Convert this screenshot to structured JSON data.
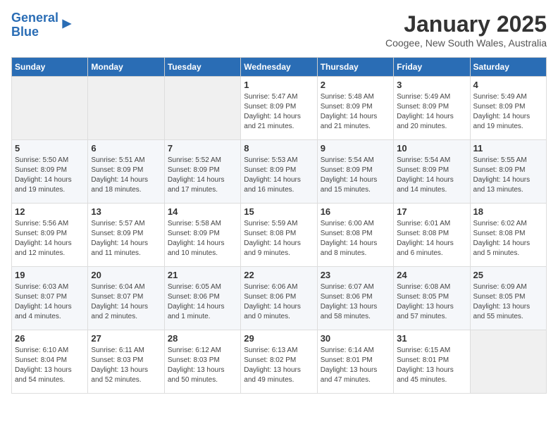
{
  "logo": {
    "text_general": "General",
    "text_blue": "Blue"
  },
  "header": {
    "title": "January 2025",
    "subtitle": "Coogee, New South Wales, Australia"
  },
  "weekdays": [
    "Sunday",
    "Monday",
    "Tuesday",
    "Wednesday",
    "Thursday",
    "Friday",
    "Saturday"
  ],
  "weeks": [
    [
      {
        "day": "",
        "info": ""
      },
      {
        "day": "",
        "info": ""
      },
      {
        "day": "",
        "info": ""
      },
      {
        "day": "1",
        "info": "Sunrise: 5:47 AM\nSunset: 8:09 PM\nDaylight: 14 hours\nand 21 minutes."
      },
      {
        "day": "2",
        "info": "Sunrise: 5:48 AM\nSunset: 8:09 PM\nDaylight: 14 hours\nand 21 minutes."
      },
      {
        "day": "3",
        "info": "Sunrise: 5:49 AM\nSunset: 8:09 PM\nDaylight: 14 hours\nand 20 minutes."
      },
      {
        "day": "4",
        "info": "Sunrise: 5:49 AM\nSunset: 8:09 PM\nDaylight: 14 hours\nand 19 minutes."
      }
    ],
    [
      {
        "day": "5",
        "info": "Sunrise: 5:50 AM\nSunset: 8:09 PM\nDaylight: 14 hours\nand 19 minutes."
      },
      {
        "day": "6",
        "info": "Sunrise: 5:51 AM\nSunset: 8:09 PM\nDaylight: 14 hours\nand 18 minutes."
      },
      {
        "day": "7",
        "info": "Sunrise: 5:52 AM\nSunset: 8:09 PM\nDaylight: 14 hours\nand 17 minutes."
      },
      {
        "day": "8",
        "info": "Sunrise: 5:53 AM\nSunset: 8:09 PM\nDaylight: 14 hours\nand 16 minutes."
      },
      {
        "day": "9",
        "info": "Sunrise: 5:54 AM\nSunset: 8:09 PM\nDaylight: 14 hours\nand 15 minutes."
      },
      {
        "day": "10",
        "info": "Sunrise: 5:54 AM\nSunset: 8:09 PM\nDaylight: 14 hours\nand 14 minutes."
      },
      {
        "day": "11",
        "info": "Sunrise: 5:55 AM\nSunset: 8:09 PM\nDaylight: 14 hours\nand 13 minutes."
      }
    ],
    [
      {
        "day": "12",
        "info": "Sunrise: 5:56 AM\nSunset: 8:09 PM\nDaylight: 14 hours\nand 12 minutes."
      },
      {
        "day": "13",
        "info": "Sunrise: 5:57 AM\nSunset: 8:09 PM\nDaylight: 14 hours\nand 11 minutes."
      },
      {
        "day": "14",
        "info": "Sunrise: 5:58 AM\nSunset: 8:09 PM\nDaylight: 14 hours\nand 10 minutes."
      },
      {
        "day": "15",
        "info": "Sunrise: 5:59 AM\nSunset: 8:08 PM\nDaylight: 14 hours\nand 9 minutes."
      },
      {
        "day": "16",
        "info": "Sunrise: 6:00 AM\nSunset: 8:08 PM\nDaylight: 14 hours\nand 8 minutes."
      },
      {
        "day": "17",
        "info": "Sunrise: 6:01 AM\nSunset: 8:08 PM\nDaylight: 14 hours\nand 6 minutes."
      },
      {
        "day": "18",
        "info": "Sunrise: 6:02 AM\nSunset: 8:08 PM\nDaylight: 14 hours\nand 5 minutes."
      }
    ],
    [
      {
        "day": "19",
        "info": "Sunrise: 6:03 AM\nSunset: 8:07 PM\nDaylight: 14 hours\nand 4 minutes."
      },
      {
        "day": "20",
        "info": "Sunrise: 6:04 AM\nSunset: 8:07 PM\nDaylight: 14 hours\nand 2 minutes."
      },
      {
        "day": "21",
        "info": "Sunrise: 6:05 AM\nSunset: 8:06 PM\nDaylight: 14 hours\nand 1 minute."
      },
      {
        "day": "22",
        "info": "Sunrise: 6:06 AM\nSunset: 8:06 PM\nDaylight: 14 hours\nand 0 minutes."
      },
      {
        "day": "23",
        "info": "Sunrise: 6:07 AM\nSunset: 8:06 PM\nDaylight: 13 hours\nand 58 minutes."
      },
      {
        "day": "24",
        "info": "Sunrise: 6:08 AM\nSunset: 8:05 PM\nDaylight: 13 hours\nand 57 minutes."
      },
      {
        "day": "25",
        "info": "Sunrise: 6:09 AM\nSunset: 8:05 PM\nDaylight: 13 hours\nand 55 minutes."
      }
    ],
    [
      {
        "day": "26",
        "info": "Sunrise: 6:10 AM\nSunset: 8:04 PM\nDaylight: 13 hours\nand 54 minutes."
      },
      {
        "day": "27",
        "info": "Sunrise: 6:11 AM\nSunset: 8:03 PM\nDaylight: 13 hours\nand 52 minutes."
      },
      {
        "day": "28",
        "info": "Sunrise: 6:12 AM\nSunset: 8:03 PM\nDaylight: 13 hours\nand 50 minutes."
      },
      {
        "day": "29",
        "info": "Sunrise: 6:13 AM\nSunset: 8:02 PM\nDaylight: 13 hours\nand 49 minutes."
      },
      {
        "day": "30",
        "info": "Sunrise: 6:14 AM\nSunset: 8:01 PM\nDaylight: 13 hours\nand 47 minutes."
      },
      {
        "day": "31",
        "info": "Sunrise: 6:15 AM\nSunset: 8:01 PM\nDaylight: 13 hours\nand 45 minutes."
      },
      {
        "day": "",
        "info": ""
      }
    ]
  ]
}
